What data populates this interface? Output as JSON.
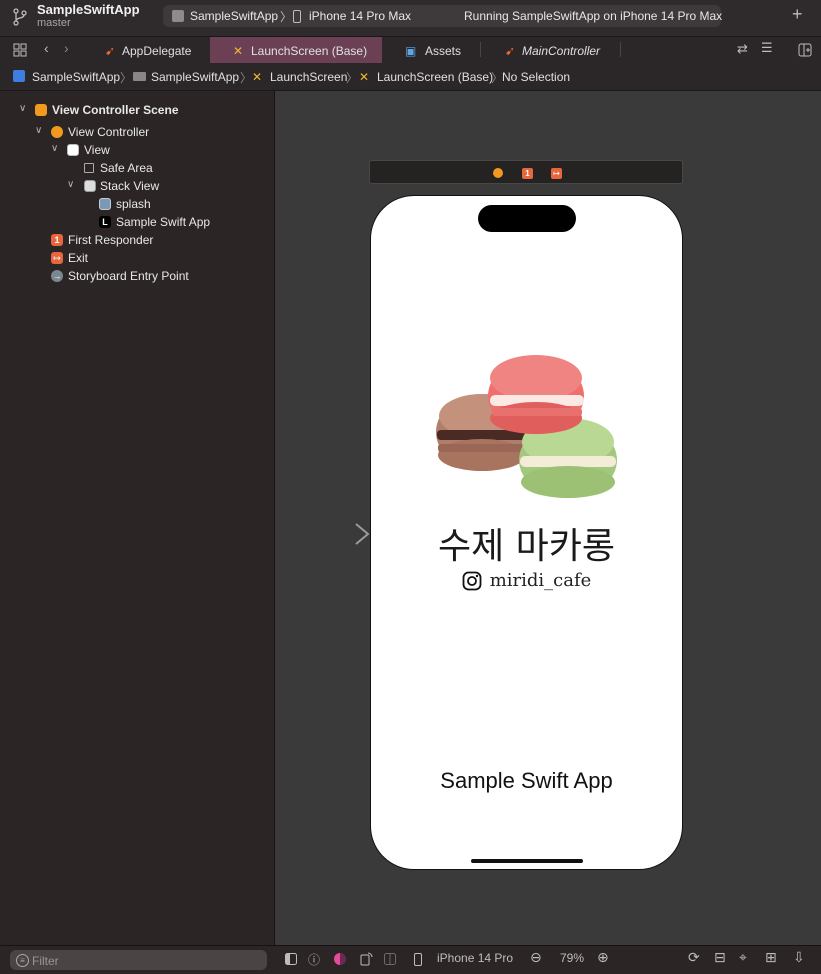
{
  "window": {
    "project": "SampleSwiftApp",
    "branch": "master",
    "scheme": "SampleSwiftApp",
    "device": "iPhone 14 Pro Max",
    "status": "Running SampleSwiftApp on iPhone 14 Pro Max",
    "add_label": "+"
  },
  "tabs": [
    {
      "label": "AppDelegate",
      "icon": "swift-file-icon"
    },
    {
      "label": "LaunchScreen (Base)",
      "icon": "storyboard-icon",
      "active": true
    },
    {
      "label": "Assets",
      "icon": "asset-catalog-icon"
    },
    {
      "label": "MainController",
      "icon": "swift-file-icon"
    }
  ],
  "breadcrumb": [
    "SampleSwiftApp",
    "SampleSwiftApp",
    "LaunchScreen",
    "LaunchScreen (Base)",
    "No Selection"
  ],
  "outline": {
    "scene": "View Controller Scene",
    "view_controller": "View Controller",
    "view": "View",
    "safe_area": "Safe Area",
    "stack_view": "Stack View",
    "splash": "splash",
    "app_label": "Sample Swift App",
    "first_responder": "First Responder",
    "exit": "Exit",
    "entry_point": "Storyboard Entry Point",
    "first_responder_badge": "1",
    "label_badge": "L"
  },
  "filter": {
    "placeholder": "Filter"
  },
  "canvas": {
    "title_korean": "수제 마카롱",
    "instagram_handle": "miridi_cafe",
    "app_name": "Sample Swift App",
    "dock_badge": "1"
  },
  "bottom_bar": {
    "device": "iPhone 14 Pro",
    "zoom": "79%"
  },
  "colors": {
    "accent_tab": "#6b4055",
    "scene_orange": "#f29a1f",
    "responder_red": "#e8663d"
  }
}
